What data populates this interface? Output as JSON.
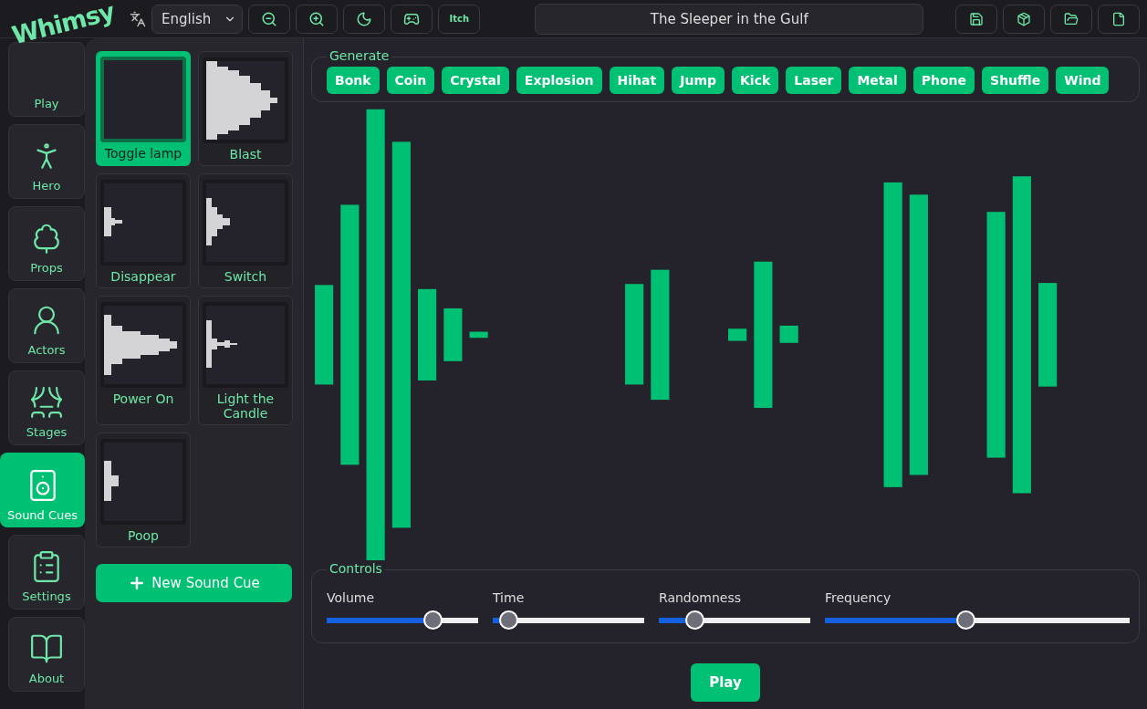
{
  "logo": "Whimsy",
  "language": {
    "value": "English"
  },
  "toolbar_text_button": "Itch",
  "project_title": "The Sleeper in the Gulf",
  "nav": [
    {
      "label": "Play",
      "selected": false
    },
    {
      "label": "Hero",
      "selected": false
    },
    {
      "label": "Props",
      "selected": false
    },
    {
      "label": "Actors",
      "selected": false
    },
    {
      "label": "Stages",
      "selected": false
    },
    {
      "label": "Sound Cues",
      "selected": true
    },
    {
      "label": "Settings",
      "selected": false
    },
    {
      "label": "About",
      "selected": false
    }
  ],
  "sound_cues": [
    {
      "label": "Toggle lamp",
      "selected": true
    },
    {
      "label": "Blast",
      "selected": false
    },
    {
      "label": "Disappear",
      "selected": false
    },
    {
      "label": "Switch",
      "selected": false
    },
    {
      "label": "Power On",
      "selected": false
    },
    {
      "label": "Light the Candle",
      "selected": false
    },
    {
      "label": "Poop",
      "selected": false
    }
  ],
  "new_cue_button": "New Sound Cue",
  "generate": {
    "title": "Generate",
    "buttons": [
      "Bonk",
      "Coin",
      "Crystal",
      "Explosion",
      "Hihat",
      "Jump",
      "Kick",
      "Laser",
      "Metal",
      "Phone",
      "Shuffle",
      "Wind"
    ]
  },
  "controls": {
    "title": "Controls",
    "sliders": [
      {
        "label": "Volume",
        "level": 0.73
      },
      {
        "label": "Time",
        "level": 0.05
      },
      {
        "label": "Randomness",
        "level": 0.2
      },
      {
        "label": "Frequency",
        "level": 0.46
      }
    ]
  },
  "play_button": "Play"
}
